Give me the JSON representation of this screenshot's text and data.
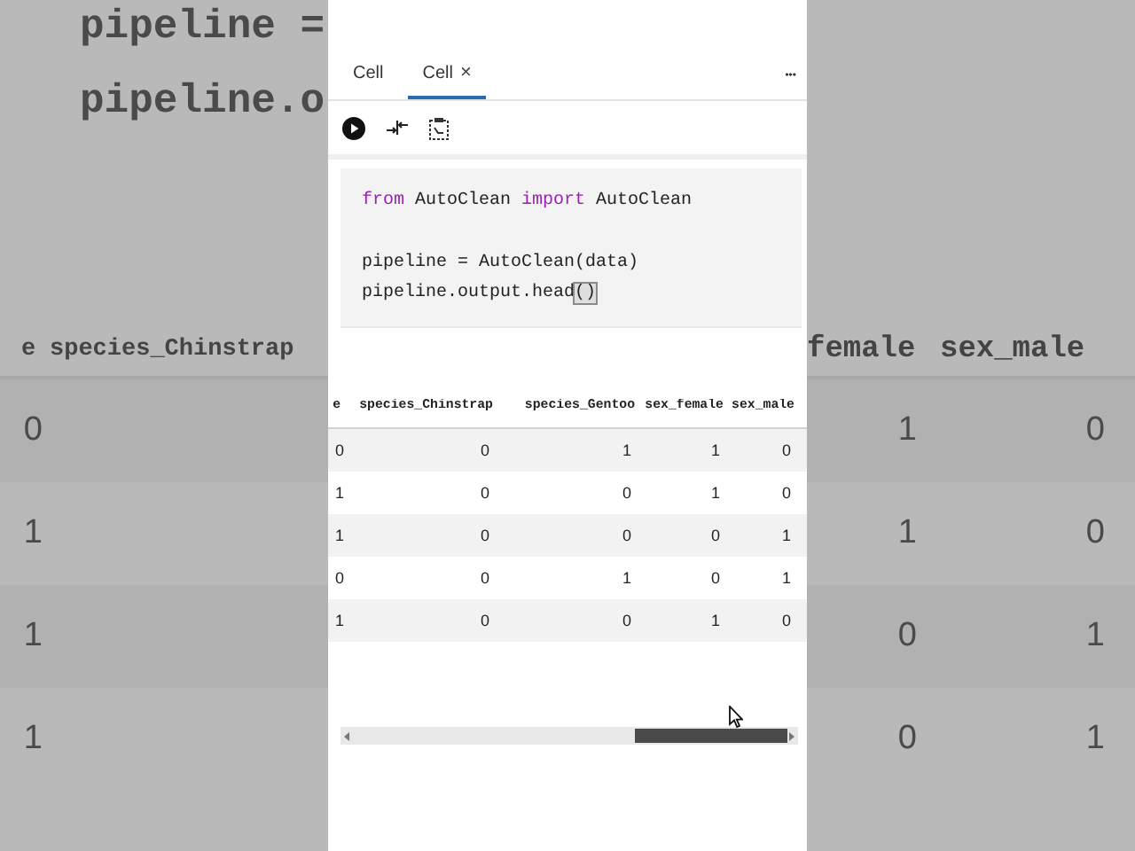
{
  "backdrop": {
    "code_lines": [
      "pipeline =",
      "pipeline.o"
    ],
    "left_header": [
      "e",
      "species_Chinstrap"
    ],
    "left_values": [
      "0",
      "1",
      "1",
      "1"
    ],
    "right_header": [
      "female",
      "sex_male"
    ],
    "right_rows": [
      [
        "1",
        "0"
      ],
      [
        "1",
        "0"
      ],
      [
        "0",
        "1"
      ],
      [
        "0",
        "1"
      ]
    ]
  },
  "tabs": [
    {
      "label": "Cell",
      "selected": false
    },
    {
      "label": "Cell",
      "selected": true,
      "close": "×"
    }
  ],
  "more_button": "•••",
  "code": {
    "blocks": [
      [
        [
          {
            "text": "from",
            "kind": "keyword"
          },
          {
            "text": " AutoClean ",
            "kind": "plain"
          },
          {
            "text": "import",
            "kind": "keyword"
          },
          {
            "text": " AutoClean",
            "kind": "plain"
          }
        ]
      ],
      [
        [
          {
            "text": "pipeline = AutoClean(data)",
            "kind": "plain"
          }
        ],
        [
          {
            "text": "pipeline.output.head",
            "kind": "plain"
          },
          {
            "text": "()",
            "kind": "bracket-match"
          }
        ]
      ]
    ]
  },
  "output_table": {
    "columns": [
      "e",
      "species_Chinstrap",
      "species_Gentoo",
      "sex_female",
      "sex_male"
    ],
    "rows": [
      [
        "0",
        "0",
        "1",
        "1",
        "0"
      ],
      [
        "1",
        "0",
        "0",
        "1",
        "0"
      ],
      [
        "1",
        "0",
        "0",
        "0",
        "1"
      ],
      [
        "0",
        "0",
        "1",
        "0",
        "1"
      ],
      [
        "1",
        "0",
        "0",
        "1",
        "0"
      ]
    ]
  }
}
